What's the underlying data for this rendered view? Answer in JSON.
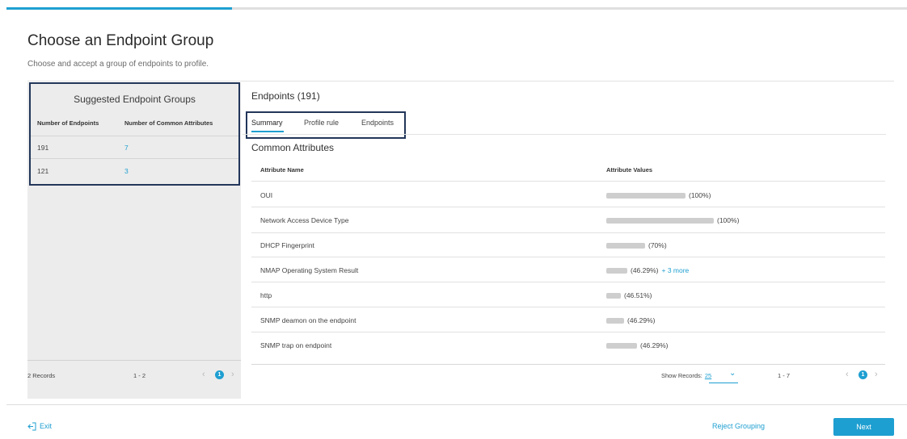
{
  "progress": {
    "percent": 25
  },
  "page": {
    "title": "Choose an Endpoint Group",
    "subtitle": "Choose and accept a group of endpoints to profile."
  },
  "suggested": {
    "title": "Suggested Endpoint Groups",
    "columns": [
      "Number of Endpoints",
      "Number of Common Attributes"
    ],
    "rows": [
      {
        "endpoints": "191",
        "attributes": "7"
      },
      {
        "endpoints": "121",
        "attributes": "3"
      }
    ],
    "footer": {
      "records": "2 Records",
      "range": "1 - 2",
      "page": "1"
    }
  },
  "endpoints": {
    "title": "Endpoints (191)",
    "tabs": [
      "Summary",
      "Profile rule",
      "Endpoints"
    ],
    "active_tab": "Summary",
    "section_title": "Common Attributes",
    "columns": [
      "Attribute Name",
      "Attribute Values"
    ],
    "rows": [
      {
        "name": "OUI",
        "value": "(100%)"
      },
      {
        "name": "Network Access Device Type",
        "value": "(100%)"
      },
      {
        "name": "DHCP Fingerprint",
        "value": "(70%)"
      },
      {
        "name": "NMAP Operating System Result",
        "value": "(46.29%)",
        "more": "+ 3 more"
      },
      {
        "name": "http",
        "value": "(46.51%)"
      },
      {
        "name": "SNMP deamon on the endpoint",
        "value": "(46.29%)"
      },
      {
        "name": "SNMP trap on endpoint",
        "value": "(46.29%)"
      }
    ],
    "footer": {
      "show_records_label": "Show Records:",
      "show_records_value": "25",
      "range": "1 - 7",
      "page": "1"
    }
  },
  "actions": {
    "exit": "Exit",
    "reject": "Reject Grouping",
    "next": "Next"
  },
  "colors": {
    "accent": "#1e9fd1",
    "highlight_border": "#22365a"
  }
}
